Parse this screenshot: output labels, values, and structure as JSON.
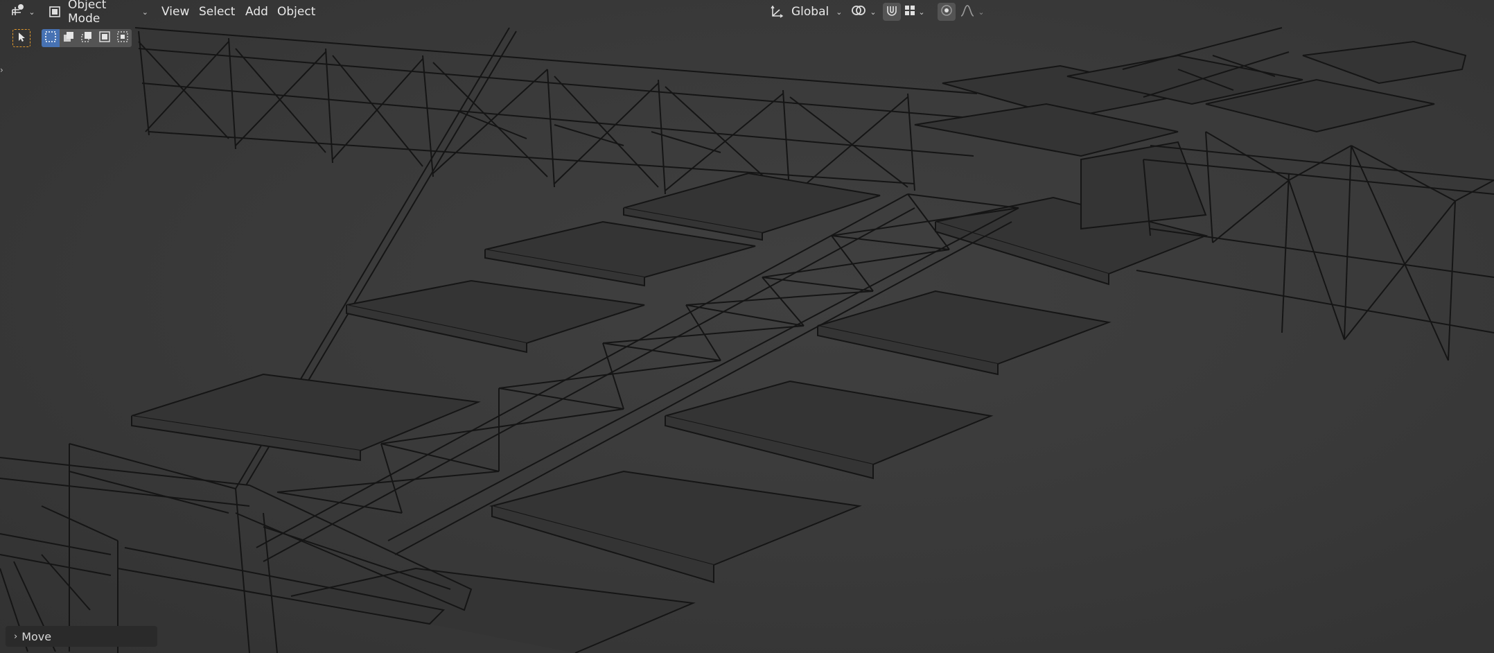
{
  "header": {
    "editor_type_icon": "object-mode-transform-icon",
    "mode_selector": {
      "icon": "object-cube-icon",
      "label": "Object Mode"
    },
    "menus": [
      "View",
      "Select",
      "Add",
      "Object"
    ],
    "transform_orientation": {
      "icon": "axes-icon",
      "label": "Global"
    },
    "pivot_icon": "link-rings-icon",
    "snap_icon": "magnet-icon",
    "snap_target_icon": "snap-grid-icon",
    "proportional_edit_icon": "dot-circle-icon",
    "falloff_icon": "falloff-curve-icon"
  },
  "toolbar": {
    "active_tool_icon": "select-cursor-icon",
    "select_modes": [
      "select-new-icon",
      "select-extend-icon",
      "select-subtract-icon",
      "select-invert-icon",
      "select-intersect-icon"
    ]
  },
  "redo_panel": {
    "label": "Move"
  },
  "colors": {
    "background": "#3a3a3a",
    "wire": "#151515",
    "panel": "#2a2a2a",
    "accent_blue": "#4772b3",
    "tool_active_orange": "#e39a2d"
  }
}
